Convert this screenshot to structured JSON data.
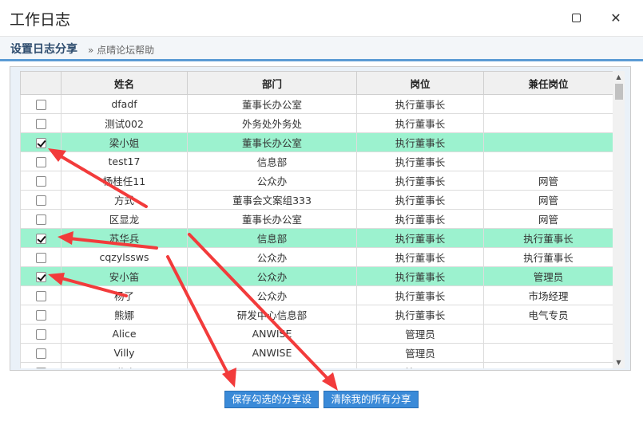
{
  "window": {
    "title": "工作日志",
    "maximize_icon": "maximize-icon",
    "close_icon": "close-icon",
    "close_glyph": "✕"
  },
  "section": {
    "title": "设置日志分享",
    "help_link": "» 点晴论坛帮助"
  },
  "table": {
    "columns": [
      "",
      "姓名",
      "部门",
      "岗位",
      "兼任岗位"
    ],
    "rows": [
      {
        "checked": false,
        "name": "dfadf",
        "dept": "董事长办公室",
        "post": "执行董事长",
        "extra": ""
      },
      {
        "checked": false,
        "name": "测试002",
        "dept": "外务处外务处",
        "post": "执行董事长",
        "extra": ""
      },
      {
        "checked": true,
        "name": "梁小姐",
        "dept": "董事长办公室",
        "post": "执行董事长",
        "extra": ""
      },
      {
        "checked": false,
        "name": "test17",
        "dept": "信息部",
        "post": "执行董事长",
        "extra": ""
      },
      {
        "checked": false,
        "name": "杨桂任11",
        "dept": "公众办",
        "post": "执行董事长",
        "extra": "网管"
      },
      {
        "checked": false,
        "name": "方式",
        "dept": "董事会文案组333",
        "post": "执行董事长",
        "extra": "网管"
      },
      {
        "checked": false,
        "name": "区显龙",
        "dept": "董事长办公室",
        "post": "执行董事长",
        "extra": "网管"
      },
      {
        "checked": true,
        "name": "苏华兵",
        "dept": "信息部",
        "post": "执行董事长",
        "extra": "执行董事长"
      },
      {
        "checked": false,
        "name": "cqzylssws",
        "dept": "公众办",
        "post": "执行董事长",
        "extra": "执行董事长"
      },
      {
        "checked": true,
        "name": "安小笛",
        "dept": "公众办",
        "post": "执行董事长",
        "extra": "管理员"
      },
      {
        "checked": false,
        "name": "杨了",
        "dept": "公众办",
        "post": "执行董事长",
        "extra": "市场经理"
      },
      {
        "checked": false,
        "name": "熊娜",
        "dept": "研发中心信息部",
        "post": "执行董事长",
        "extra": "电气专员"
      },
      {
        "checked": false,
        "name": "Alice",
        "dept": "ANWISE",
        "post": "管理员",
        "extra": ""
      },
      {
        "checked": false,
        "name": "Villy",
        "dept": "ANWISE",
        "post": "管理员",
        "extra": ""
      },
      {
        "checked": false,
        "name": "Olivia",
        "dept": "ANWISE",
        "post": "管理员",
        "extra": ""
      }
    ]
  },
  "buttons": {
    "save": "保存勾选的分享设置",
    "clear": "清除我的所有分享"
  },
  "colors": {
    "selected_row": "#9cf2cf",
    "accent": "#3a8ad8",
    "annotation": "#f23b3b"
  }
}
